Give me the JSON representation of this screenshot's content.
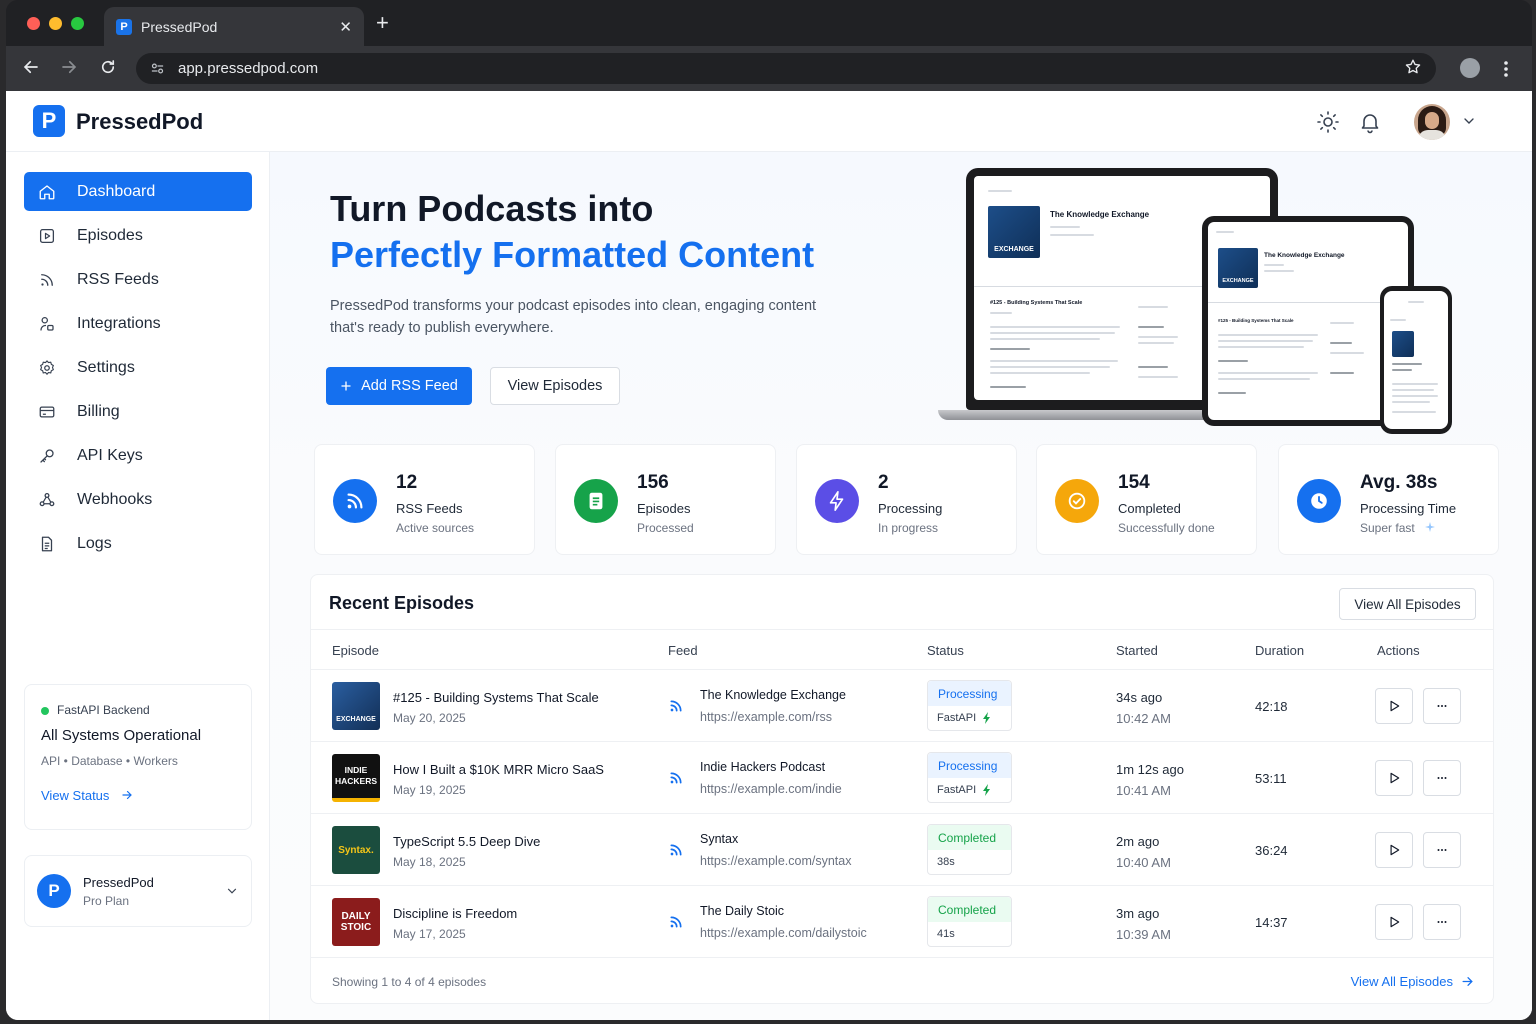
{
  "browser": {
    "tab_title": "PressedPod",
    "tab_favicon": "P",
    "close_glyph": "✕",
    "newtab_glyph": "+",
    "url": "app.pressedpod.com"
  },
  "app": {
    "logo_letter": "P",
    "brand": "PressedPod",
    "accent": "#1570ef"
  },
  "sidebar": {
    "items": [
      {
        "label": "Dashboard",
        "icon": "home-icon",
        "active": true
      },
      {
        "label": "Episodes",
        "icon": "play-square-icon"
      },
      {
        "label": "RSS Feeds",
        "icon": "rss-icon"
      },
      {
        "label": "Integrations",
        "icon": "integrations-icon"
      },
      {
        "label": "Settings",
        "icon": "gear-icon"
      },
      {
        "label": "Billing",
        "icon": "credit-card-icon"
      },
      {
        "label": "API Keys",
        "icon": "key-icon"
      },
      {
        "label": "Webhooks",
        "icon": "webhook-icon"
      },
      {
        "label": "Logs",
        "icon": "document-icon"
      }
    ],
    "status_card": {
      "label": "FastAPI Backend",
      "title": "All Systems Operational",
      "services": "API  •  Database  •  Workers",
      "link": "View Status"
    },
    "plan": {
      "initial": "P",
      "name": "PressedPod",
      "plan": "Pro Plan"
    }
  },
  "hero": {
    "title_line1": "Turn Podcasts into",
    "title_line2": "Perfectly Formatted Content",
    "description": "PressedPod transforms your podcast episodes into clean, engaging content that's ready to publish everywhere.",
    "primary_button": "Add RSS Feed",
    "secondary_button": "View Episodes",
    "mockup": {
      "show_title": "The Knowledge Exchange",
      "cover_text": "EXCHANGE",
      "episode": "#125 - Building Systems That Scale"
    }
  },
  "stats": [
    {
      "value": "12",
      "label": "RSS Feeds",
      "sub": "Active sources",
      "color": "#1570ef",
      "icon": "rss-icon"
    },
    {
      "value": "156",
      "label": "Episodes",
      "sub": "Processed",
      "color": "#16a34a",
      "icon": "document-icon"
    },
    {
      "value": "2",
      "label": "Processing",
      "sub": "In progress",
      "color": "#5b4ee6",
      "icon": "lightning-icon"
    },
    {
      "value": "154",
      "label": "Completed",
      "sub": "Successfully done",
      "color": "#f5a70b",
      "icon": "check-circle-icon"
    },
    {
      "value": "Avg. 38s",
      "label": "Processing Time",
      "sub": "Super fast",
      "color": "#1570ef",
      "icon": "clock-icon"
    }
  ],
  "recent": {
    "title": "Recent Episodes",
    "view_all_button": "View All Episodes",
    "columns": [
      "Episode",
      "Feed",
      "Status",
      "Started",
      "Duration",
      "Actions"
    ],
    "rows": [
      {
        "title": "#125 - Building Systems That Scale",
        "date": "May 20, 2025",
        "cover_text": "EXCHANGE",
        "cover_color": "#1d4e89",
        "feed": "The Knowledge Exchange",
        "url": "https://example.com/rss",
        "status": "Processing",
        "meta": "FastAPI",
        "started": "34s ago",
        "time": "10:42 AM",
        "duration": "42:18"
      },
      {
        "title": "How I Built a $10K MRR Micro SaaS",
        "date": "May 19, 2025",
        "cover_text": "INDIE HACKERS",
        "cover_color": "#111111",
        "feed": "Indie Hackers Podcast",
        "url": "https://example.com/indie",
        "status": "Processing",
        "meta": "FastAPI",
        "started": "1m 12s ago",
        "time": "10:41 AM",
        "duration": "53:11"
      },
      {
        "title": "TypeScript 5.5 Deep Dive",
        "date": "May 18, 2025",
        "cover_text": "Syntax.",
        "cover_color": "#1b4d3e",
        "feed": "Syntax",
        "url": "https://example.com/syntax",
        "status": "Completed",
        "meta": "38s",
        "started": "2m ago",
        "time": "10:40 AM",
        "duration": "36:24"
      },
      {
        "title": "Discipline is Freedom",
        "date": "May 17, 2025",
        "cover_text": "DAILY STOIC",
        "cover_color": "#8b1c1c",
        "feed": "The Daily Stoic",
        "url": "https://example.com/dailystoic",
        "status": "Completed",
        "meta": "41s",
        "started": "3m ago",
        "time": "10:39 AM",
        "duration": "14:37"
      }
    ],
    "footer": "Showing 1 to 4 of 4 episodes",
    "footer_link": "View All Episodes"
  }
}
